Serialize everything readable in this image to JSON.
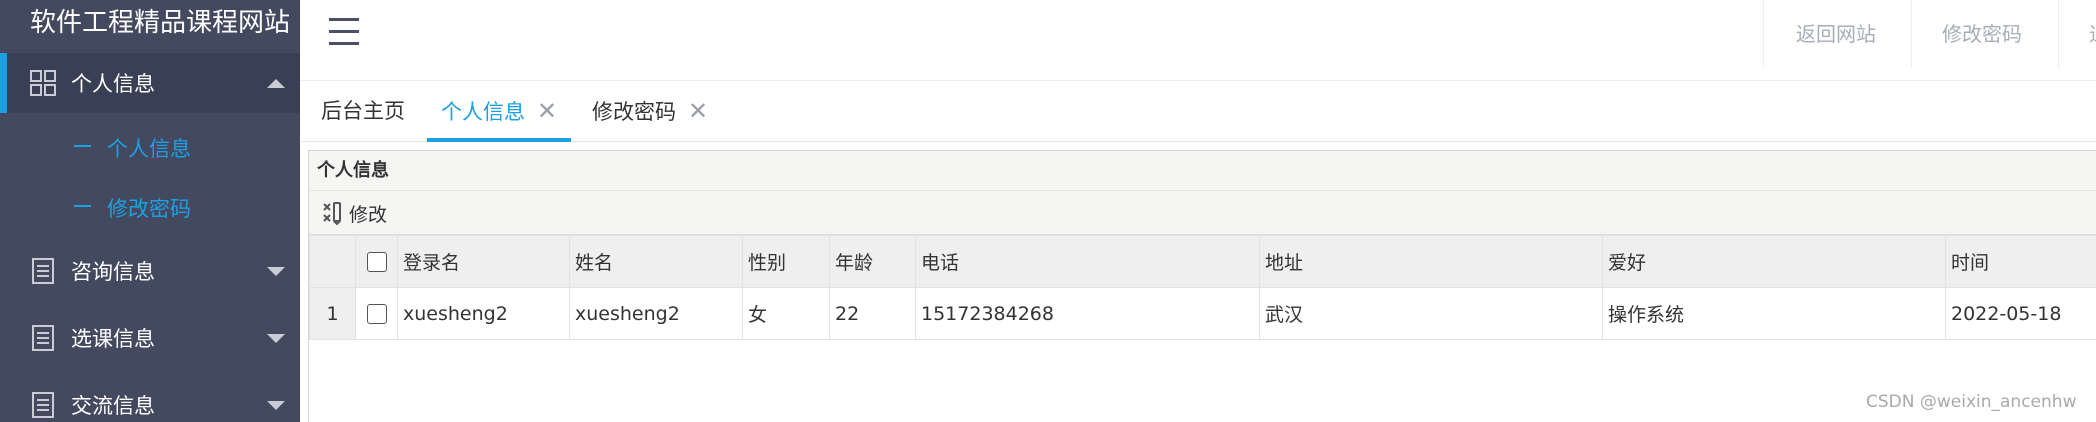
{
  "site_title": "软件工程精品课程网站",
  "sidebar": {
    "menus": [
      {
        "label": "个人信息",
        "icon": "grid-icon",
        "expanded": true,
        "sub": [
          "个人信息",
          "修改密码"
        ]
      },
      {
        "label": "咨询信息",
        "icon": "document-icon",
        "expanded": false
      },
      {
        "label": "选课信息",
        "icon": "document-icon",
        "expanded": false
      },
      {
        "label": "交流信息",
        "icon": "document-icon",
        "expanded": false
      }
    ]
  },
  "header": {
    "menu_icon": "hamburger-icon",
    "links": [
      "返回网站",
      "修改密码",
      "退"
    ]
  },
  "tabs": [
    {
      "label": "后台主页",
      "closable": false
    },
    {
      "label": "个人信息",
      "closable": true,
      "active": true
    },
    {
      "label": "修改密码",
      "closable": true
    }
  ],
  "tab_close_glyph": "✕",
  "panel": {
    "title": "个人信息",
    "toolbar": {
      "edit_label": "修改",
      "edit_icon": "edit-icon"
    },
    "columns": [
      "登录名",
      "姓名",
      "性别",
      "年龄",
      "电话",
      "地址",
      "爱好",
      "时间"
    ],
    "rows": [
      {
        "index": "1",
        "cells": [
          "xuesheng2",
          "xuesheng2",
          "女",
          "22",
          "15172384268",
          "武汉",
          "操作系统",
          "2022-05-18"
        ]
      }
    ]
  },
  "watermark": "CSDN @weixin_ancenhw",
  "colors": {
    "sidebar": "#434a60",
    "accent": "#1e9fe4"
  }
}
